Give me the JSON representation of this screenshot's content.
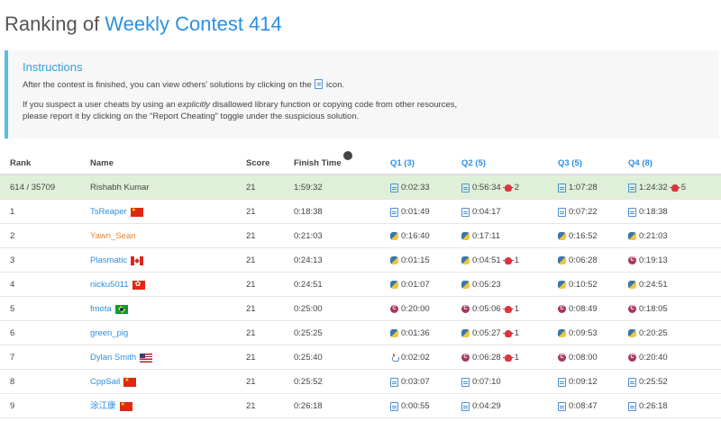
{
  "title": {
    "prefix": "Ranking of ",
    "contest": "Weekly Contest 414"
  },
  "instructions": {
    "heading": "Instructions",
    "line1_before": "After the contest is finished, you can view others' solutions by clicking on the",
    "line1_after": "icon.",
    "line2_before": "If you suspect a user cheats by using an",
    "line2_emph": "explicitly",
    "line2_after": "disallowed library function or copying code from other resources,",
    "line3": "please report it by clicking on the \"Report Cheating\" toggle under the suspicious solution."
  },
  "headers": {
    "rank": "Rank",
    "name": "Name",
    "score": "Score",
    "finish_time": "Finish Time",
    "q1": "Q1 (3)",
    "q2": "Q2 (5)",
    "q3": "Q3 (5)",
    "q4": "Q4 (8)"
  },
  "rows": [
    {
      "rank": "614 / 35709",
      "name": "Rishabh Kumar",
      "flag": "",
      "score": "21",
      "finish": "1:59:32",
      "q1": {
        "time": "0:02:33",
        "lang": "doc-icon",
        "bugs": ""
      },
      "q2": {
        "time": "0:56:34",
        "lang": "doc-icon",
        "bugs": "2"
      },
      "q3": {
        "time": "1:07:28",
        "lang": "doc-icon",
        "bugs": ""
      },
      "q4": {
        "time": "1:24:32",
        "lang": "doc-icon",
        "bugs": "5"
      }
    },
    {
      "rank": "1",
      "name": "TsReaper",
      "flag": "cn",
      "score": "21",
      "finish": "0:18:38",
      "q1": {
        "time": "0:01:49",
        "lang": "doc-icon",
        "bugs": ""
      },
      "q2": {
        "time": "0:04:17",
        "lang": "doc-icon",
        "bugs": ""
      },
      "q3": {
        "time": "0:07:22",
        "lang": "doc-icon",
        "bugs": ""
      },
      "q4": {
        "time": "0:18:38",
        "lang": "doc-icon",
        "bugs": ""
      }
    },
    {
      "rank": "2",
      "name": "Yawn_Sean",
      "flag": "",
      "score": "21",
      "finish": "0:21:03",
      "q1": {
        "time": "0:16:40",
        "lang": "python-icon",
        "bugs": ""
      },
      "q2": {
        "time": "0:17:11",
        "lang": "python-icon",
        "bugs": ""
      },
      "q3": {
        "time": "0:16:52",
        "lang": "python-icon",
        "bugs": ""
      },
      "q4": {
        "time": "0:21:03",
        "lang": "python-icon",
        "bugs": ""
      }
    },
    {
      "rank": "3",
      "name": "Plasmatic",
      "flag": "ca",
      "score": "21",
      "finish": "0:24:13",
      "q1": {
        "time": "0:01:15",
        "lang": "python-icon",
        "bugs": ""
      },
      "q2": {
        "time": "0:04:51",
        "lang": "python-icon",
        "bugs": "1"
      },
      "q3": {
        "time": "0:06:28",
        "lang": "python-icon",
        "bugs": ""
      },
      "q4": {
        "time": "0:19:13",
        "lang": "cpp-icon",
        "bugs": ""
      }
    },
    {
      "rank": "4",
      "name": "nicku5011",
      "flag": "hk",
      "score": "21",
      "finish": "0:24:51",
      "q1": {
        "time": "0:01:07",
        "lang": "python-icon",
        "bugs": ""
      },
      "q2": {
        "time": "0:05:23",
        "lang": "python-icon",
        "bugs": ""
      },
      "q3": {
        "time": "0:10:52",
        "lang": "python-icon",
        "bugs": ""
      },
      "q4": {
        "time": "0:24:51",
        "lang": "python-icon",
        "bugs": ""
      }
    },
    {
      "rank": "5",
      "name": "fmota",
      "flag": "br",
      "score": "21",
      "finish": "0:25:00",
      "q1": {
        "time": "0:20:00",
        "lang": "cpp-icon",
        "bugs": ""
      },
      "q2": {
        "time": "0:05:06",
        "lang": "cpp-icon",
        "bugs": "1"
      },
      "q3": {
        "time": "0:08:49",
        "lang": "cpp-icon",
        "bugs": ""
      },
      "q4": {
        "time": "0:18:05",
        "lang": "cpp-icon",
        "bugs": ""
      }
    },
    {
      "rank": "6",
      "name": "green_pig",
      "flag": "",
      "score": "21",
      "finish": "0:25:25",
      "q1": {
        "time": "0:01:36",
        "lang": "python-icon",
        "bugs": ""
      },
      "q2": {
        "time": "0:05:27",
        "lang": "python-icon",
        "bugs": "1"
      },
      "q3": {
        "time": "0:09:53",
        "lang": "python-icon",
        "bugs": ""
      },
      "q4": {
        "time": "0:20:25",
        "lang": "python-icon",
        "bugs": ""
      }
    },
    {
      "rank": "7",
      "name": "Dylan Smith",
      "flag": "us",
      "score": "21",
      "finish": "0:25:40",
      "q1": {
        "time": "0:02:02",
        "lang": "java-icon",
        "bugs": ""
      },
      "q2": {
        "time": "0:06:28",
        "lang": "cpp-icon",
        "bugs": "1"
      },
      "q3": {
        "time": "0:08:00",
        "lang": "cpp-icon",
        "bugs": ""
      },
      "q4": {
        "time": "0:20:40",
        "lang": "cpp-icon",
        "bugs": ""
      }
    },
    {
      "rank": "8",
      "name": "CppSail",
      "flag": "cn",
      "score": "21",
      "finish": "0:25:52",
      "q1": {
        "time": "0:03:07",
        "lang": "doc-icon",
        "bugs": ""
      },
      "q2": {
        "time": "0:07:10",
        "lang": "doc-icon",
        "bugs": ""
      },
      "q3": {
        "time": "0:09:12",
        "lang": "doc-icon",
        "bugs": ""
      },
      "q4": {
        "time": "0:25:52",
        "lang": "doc-icon",
        "bugs": ""
      }
    },
    {
      "rank": "9",
      "name": "涂江康",
      "flag": "cn",
      "score": "21",
      "finish": "0:26:18",
      "q1": {
        "time": "0:00:55",
        "lang": "doc-icon",
        "bugs": ""
      },
      "q2": {
        "time": "0:04:29",
        "lang": "doc-icon",
        "bugs": ""
      },
      "q3": {
        "time": "0:08:47",
        "lang": "doc-icon",
        "bugs": ""
      },
      "q4": {
        "time": "0:26:18",
        "lang": "doc-icon",
        "bugs": ""
      }
    }
  ]
}
